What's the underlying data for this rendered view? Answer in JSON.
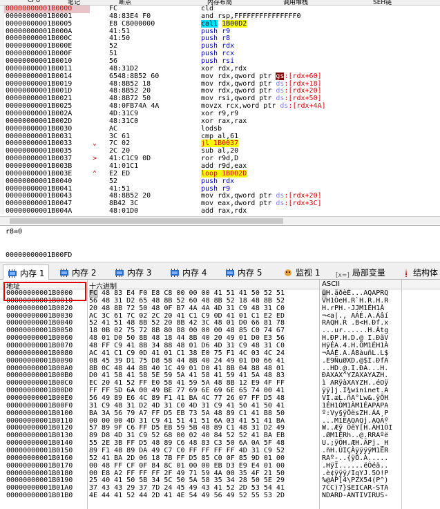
{
  "toolbar_tabs": [
    "CPU",
    "笔记",
    "断点",
    "内存布局",
    "调用堆栈",
    "SEH链"
  ],
  "disassembly": [
    {
      "addr": "00000000001B0000",
      "bytes": "FC",
      "ins": [
        [
          "cld",
          ""
        ]
      ],
      "sel": true
    },
    {
      "addr": "00000000001B0001",
      "bytes": "48:83E4 F0",
      "ins": [
        [
          "and rsp,FFFFFFFFFFFFFFF0",
          ""
        ]
      ]
    },
    {
      "addr": "00000000001B0005",
      "bytes": "E8 C8000000",
      "ins": [
        [
          "call",
          "cyan"
        ],
        [
          " ",
          ""
        ],
        [
          "1B00D2",
          "yellow"
        ]
      ]
    },
    {
      "addr": "00000000001B000A",
      "bytes": "41:51",
      "ins": [
        [
          "push r9",
          "blue"
        ]
      ]
    },
    {
      "addr": "00000000001B000C",
      "bytes": "41:50",
      "ins": [
        [
          "push r8",
          "blue"
        ]
      ]
    },
    {
      "addr": "00000000001B000E",
      "bytes": "52",
      "ins": [
        [
          "push rdx",
          "blue"
        ]
      ]
    },
    {
      "addr": "00000000001B000F",
      "bytes": "51",
      "ins": [
        [
          "push rcx",
          "blue"
        ]
      ]
    },
    {
      "addr": "00000000001B0010",
      "bytes": "56",
      "ins": [
        [
          "push rsi",
          "blue"
        ]
      ]
    },
    {
      "addr": "00000000001B0011",
      "bytes": "48:31D2",
      "ins": [
        [
          "xor rdx,rdx",
          ""
        ]
      ]
    },
    {
      "addr": "00000000001B0014",
      "bytes": "6548:8B52 60",
      "ins": [
        [
          "mov rdx,qword ptr ",
          ""
        ],
        [
          "gs",
          "maroon"
        ],
        [
          ":[rdx+60]",
          "red"
        ]
      ]
    },
    {
      "addr": "00000000001B0019",
      "bytes": "48:8B52 18",
      "ins": [
        [
          "mov rdx,qword ptr ",
          ""
        ],
        [
          "ds",
          "seg"
        ],
        [
          ":[rdx+18]",
          "red"
        ]
      ]
    },
    {
      "addr": "00000000001B001D",
      "bytes": "48:8B52 20",
      "ins": [
        [
          "mov rdx,qword ptr ",
          ""
        ],
        [
          "ds",
          "seg"
        ],
        [
          ":[rdx+20]",
          "red"
        ]
      ]
    },
    {
      "addr": "00000000001B0021",
      "bytes": "48:8B72 50",
      "ins": [
        [
          "mov rsi,qword ptr ",
          ""
        ],
        [
          "ds",
          "seg"
        ],
        [
          ":[rdx+50]",
          "red"
        ]
      ]
    },
    {
      "addr": "00000000001B0025",
      "bytes": "48:0FB74A 4A",
      "ins": [
        [
          "movzx rcx,word ptr ",
          ""
        ],
        [
          "ds",
          "seg"
        ],
        [
          ":[rdx+4A]",
          "red"
        ]
      ]
    },
    {
      "addr": "00000000001B002A",
      "bytes": "4D:31C9",
      "ins": [
        [
          "xor r9,r9",
          ""
        ]
      ]
    },
    {
      "addr": "00000000001B002D",
      "bytes": "48:31C0",
      "ins": [
        [
          "xor rax,rax",
          ""
        ]
      ]
    },
    {
      "addr": "00000000001B0030",
      "bytes": "AC",
      "ins": [
        [
          "lodsb",
          ""
        ]
      ]
    },
    {
      "addr": "00000000001B0031",
      "bytes": "3C 61",
      "ins": [
        [
          "cmp al,61",
          ""
        ]
      ]
    },
    {
      "addr": "00000000001B0033",
      "bytes": "7C 02",
      "arrow": "⌄",
      "ins": [
        [
          "jl 1B0037",
          "yellowred"
        ]
      ]
    },
    {
      "addr": "00000000001B0035",
      "bytes": "2C 20",
      "ins": [
        [
          "sub al,20",
          ""
        ]
      ]
    },
    {
      "addr": "00000000001B0037",
      "bytes": "41:C1C9 0D",
      "arrow": ">",
      "ins": [
        [
          "ror r9d,D",
          ""
        ]
      ]
    },
    {
      "addr": "00000000001B003B",
      "bytes": "41:01C1",
      "ins": [
        [
          "add r9d,eax",
          ""
        ]
      ]
    },
    {
      "addr": "00000000001B003E",
      "bytes": "E2 ED",
      "arrow": "⌃",
      "ins": [
        [
          "loop 1B002D",
          "yellowred"
        ]
      ]
    },
    {
      "addr": "00000000001B0040",
      "bytes": "52",
      "ins": [
        [
          "push rdx",
          "blue"
        ]
      ]
    },
    {
      "addr": "00000000001B0041",
      "bytes": "41:51",
      "ins": [
        [
          "push r9",
          "blue"
        ]
      ]
    },
    {
      "addr": "00000000001B0043",
      "bytes": "48:8B52 20",
      "ins": [
        [
          "mov rdx,qword ptr ",
          ""
        ],
        [
          "ds",
          "seg"
        ],
        [
          ":[rdx+20]",
          "red"
        ]
      ]
    },
    {
      "addr": "00000000001B0047",
      "bytes": "8B42 3C",
      "ins": [
        [
          "mov eax,dword ptr ",
          ""
        ],
        [
          "ds",
          "seg"
        ],
        [
          ":[rdx+3C]",
          "red"
        ]
      ]
    },
    {
      "addr": "00000000001B004A",
      "bytes": "48:01D0",
      "ins": [
        [
          "add rax,rdx",
          ""
        ]
      ]
    }
  ],
  "info": {
    "line1": "r8=0",
    "line2": "00000000001B00FD"
  },
  "tabs": [
    {
      "label": "内存 1",
      "icon": "memory-icon",
      "active": true
    },
    {
      "label": "内存 2",
      "icon": "memory-icon"
    },
    {
      "label": "内存 3",
      "icon": "memory-icon"
    },
    {
      "label": "内存 4",
      "icon": "memory-icon"
    },
    {
      "label": "内存 5",
      "icon": "memory-icon"
    },
    {
      "label": "监视 1",
      "icon": "watch-icon"
    },
    {
      "label": "局部变量",
      "icon": "locals-icon",
      "prefix": "[x=]"
    },
    {
      "label": "结构体",
      "icon": "struct-icon"
    }
  ],
  "memory": {
    "headers": {
      "address": "地址",
      "hex": "十六进制",
      "ascii": "ASCII"
    },
    "rows": [
      {
        "addr": "00000000001B0000",
        "hex": "FC 48 83 E4 F0 E8 C8 00 00 00 41 51 41 50 52 51",
        "ascii": "üH.äðèÈ...AQAPRQ"
      },
      {
        "addr": "00000000001B0010",
        "hex": "56 48 31 D2 65 48 8B 52 60 48 8B 52 18 48 8B 52",
        "ascii": "VH1ÒeH.R`H.R.H.R"
      },
      {
        "addr": "00000000001B0020",
        "hex": "20 48 8B 72 50 48 0F B7 4A 4A 4D 31 C9 48 31 C0",
        "ascii": " H.rPH.·JJM1ÉH1À"
      },
      {
        "addr": "00000000001B0030",
        "hex": "AC 3C 61 7C 02 2C 20 41 C1 C9 0D 41 01 C1 E2 ED",
        "ascii": "¬<a|., AÁÉ.A.Áâí"
      },
      {
        "addr": "00000000001B0040",
        "hex": "52 41 51 48 8B 52 20 8B 42 3C 48 01 D0 66 81 78",
        "ascii": "RAQH.R .B<H.Ðf.x"
      },
      {
        "addr": "00000000001B0050",
        "hex": "18 0B 02 75 72 8B 80 88 00 00 00 48 85 C0 74 67",
        "ascii": "...ur......H.Àtg"
      },
      {
        "addr": "00000000001B0060",
        "hex": "48 01 D0 50 8B 48 18 44 8B 40 20 49 01 D0 E3 56",
        "ascii": "H.ÐP.H.D.@ I.ÐãV"
      },
      {
        "addr": "00000000001B0070",
        "hex": "48 FF C9 41 8B 34 88 48 01 D6 4D 31 C9 48 31 C0",
        "ascii": "HÿÉA.4.H.ÖM1ÉH1À"
      },
      {
        "addr": "00000000001B0080",
        "hex": "AC 41 C1 C9 0D 41 01 C1 38 E0 75 F1 4C 03 4C 24",
        "ascii": "¬AÁÉ.A.Á8àuñL.L$"
      },
      {
        "addr": "00000000001B0090",
        "hex": "08 45 39 D1 75 D8 58 44 8B 40 24 49 01 D0 66 41",
        "ascii": ".E9ÑuØXD.@$I.ÐfA"
      },
      {
        "addr": "00000000001B00A0",
        "hex": "8B 0C 48 44 8B 40 1C 49 01 D0 41 8B 04 88 48 01",
        "ascii": "..HD.@.I.ÐA...H."
      },
      {
        "addr": "00000000001B00B0",
        "hex": "D0 41 58 41 58 5E 59 5A 41 58 41 59 41 5A 48 83",
        "ascii": "ÐAXAX^YZAXAYAZH."
      },
      {
        "addr": "00000000001B00C0",
        "hex": "EC 20 41 52 FF E0 58 41 59 5A 48 8B 12 E9 4F FF",
        "ascii": "ì ARÿàXAYZH..éOÿ"
      },
      {
        "addr": "00000000001B00D0",
        "hex": "FF FF 5D 6A 00 49 BE 77 69 6E 69 6E 65 74 00 41",
        "ascii": "ÿÿ]j.I¾wininet.A"
      },
      {
        "addr": "00000000001B00E0",
        "hex": "56 49 89 E6 4C 89 F1 41 BA 4C 77 26 07 FF D5 48",
        "ascii": "VI.æL.ñA°Lw&.ÿÕH"
      },
      {
        "addr": "00000000001B00F0",
        "hex": "31 C9 48 31 D2 4D 31 C0 4D 31 C9 41 50 41 50 41",
        "ascii": "1ÉH1ÒM1ÀM1ÉAPAPA"
      },
      {
        "addr": "00000000001B0100",
        "hex": "BA 3A 56 79 A7 FF D5 EB 73 5A 48 89 C1 41 B8 50",
        "ascii": "º:Vy§ÿÕësZH.ÁA¸P"
      },
      {
        "addr": "00000000001B0110",
        "hex": "00 00 00 4D 31 C9 41 51 41 51 6A 03 41 51 41 BA",
        "ascii": "...M1ÉAQAQj.AQAº"
      },
      {
        "addr": "00000000001B0120",
        "hex": "57 89 9F C6 FF D5 EB 59 5B 48 89 C1 48 31 D2 49",
        "ascii": "W..Æÿ ÕëY[H.ÁH1ÒI"
      },
      {
        "addr": "00000000001B0130",
        "hex": "89 D8 4D 31 C9 52 68 00 02 40 84 52 52 41 BA EB",
        "ascii": ".ØM1ÉRh..@.RRAºë"
      },
      {
        "addr": "00000000001B0140",
        "hex": "55 2E 3B FF D5 48 89 C6 48 83 C3 50 6A 0A 5F 48",
        "ascii": "U.;ÿÕH.ÆH.ÃPj._H"
      },
      {
        "addr": "00000000001B0150",
        "hex": "89 F1 48 89 DA 49 C7 C0 FF FF FF FF 4D 31 C9 52",
        "ascii": ".ñH.ÚIÇÀÿÿÿÿM1ÉR"
      },
      {
        "addr": "00000000001B0160",
        "hex": "52 41 BA 2D 06 18 7B FF D5 85 C0 0F 85 9D 01 00",
        "ascii": "RAº-..{ÿÕ.À....."
      },
      {
        "addr": "00000000001B0170",
        "hex": "00 48 FF CF 0F 84 8C 01 00 00 EB D3 E9 E4 01 00",
        "ascii": ".HÿÏ......ëÓéä.."
      },
      {
        "addr": "00000000001B0180",
        "hex": "00 E8 A2 FF FF FF 2F 49 71 59 4A 00 35 4F 21 50",
        "ascii": ".è¢ÿÿÿ/IqYJ.5O!P"
      },
      {
        "addr": "00000000001B0190",
        "hex": "25 40 41 50 5B 34 5C 50 5A 58 35 34 28 50 5E 29",
        "ascii": "%@AP[4\\PZX54(P^)"
      },
      {
        "addr": "00000000001B01A0",
        "hex": "37 43 43 29 37 7D 24 45 49 43 41 52 2D 53 54 41",
        "ascii": "7CC)7}$EICAR-STA"
      },
      {
        "addr": "00000000001B01B0",
        "hex": "4E 44 41 52 44 2D 41 4E 54 49 56 49 52 55 53 2D",
        "ascii": "NDARD-ANTIVIRUS-"
      }
    ]
  },
  "colors": {
    "accent": "#e00000",
    "selected_addr_bg": "#e8c4c8",
    "call_bg": "#00e0ff",
    "target_bg": "#ffff00"
  }
}
